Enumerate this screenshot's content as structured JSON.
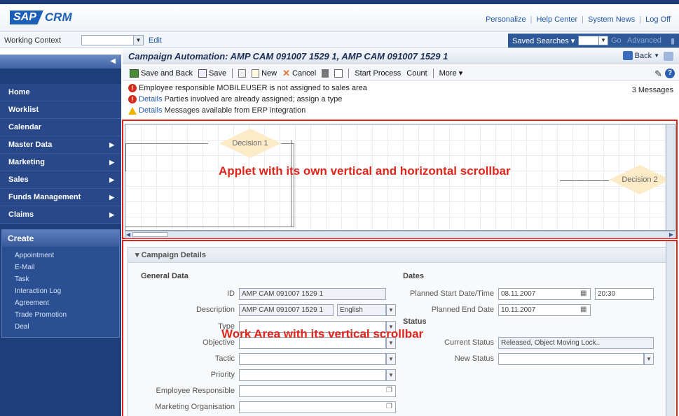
{
  "header": {
    "logo_sap": "SAP",
    "logo_product": "CRM",
    "links": [
      "Personalize",
      "Help Center",
      "System News",
      "Log Off"
    ]
  },
  "working_context": {
    "label": "Working Context",
    "value": "",
    "edit_label": "Edit",
    "saved_searches_label": "Saved Searches ▾",
    "go_label": "Go",
    "advanced_label": "Advanced"
  },
  "sidebar": {
    "items": [
      {
        "label": "Home",
        "has_arrow": false
      },
      {
        "label": "Worklist",
        "has_arrow": false
      },
      {
        "label": "Calendar",
        "has_arrow": false
      },
      {
        "label": "Master Data",
        "has_arrow": true
      },
      {
        "label": "Marketing",
        "has_arrow": true
      },
      {
        "label": "Sales",
        "has_arrow": true
      },
      {
        "label": "Funds Management",
        "has_arrow": true
      },
      {
        "label": "Claims",
        "has_arrow": true
      }
    ],
    "create_title": "Create",
    "create_items": [
      "Appointment",
      "E-Mail",
      "Task",
      "Interaction Log",
      "Agreement",
      "Trade Promotion",
      "Deal"
    ]
  },
  "page": {
    "title": "Campaign Automation: AMP CAM 091007 1529 1, AMP CAM 091007 1529 1",
    "back_label": "Back"
  },
  "toolbar": {
    "save_back": "Save and Back",
    "save": "Save",
    "new": "New",
    "cancel": "Cancel",
    "start_process": "Start Process",
    "count": "Count",
    "more": "More ▾"
  },
  "messages": {
    "count_label": "3 Messages",
    "list": [
      {
        "type": "error",
        "link": "",
        "text": "Employee responsible MOBILEUSER is not assigned to sales area"
      },
      {
        "type": "error",
        "link": "Details",
        "text": "Parties involved are already assigned; assign a type"
      },
      {
        "type": "warning",
        "link": "Details",
        "text": "Messages available from ERP integration"
      }
    ]
  },
  "applet": {
    "decision1": "Decision 1",
    "decision2": "Decision 2",
    "annotation": "Applet with its own vertical and horizontal scrollbar"
  },
  "work_area": {
    "annotation": "Work Area with its vertical scrollbar",
    "panel_title": "Campaign Details",
    "general_title": "General Data",
    "dates_title": "Dates",
    "status_title": "Status",
    "fields": {
      "id_label": "ID",
      "id_value": "AMP CAM 091007 1529 1",
      "description_label": "Description",
      "description_value": "AMP CAM 091007 1529 1",
      "language_value": "English",
      "type_label": "Type",
      "objective_label": "Objective",
      "tactic_label": "Tactic",
      "priority_label": "Priority",
      "employee_label": "Employee Responsible",
      "marketing_org_label": "Marketing Organisation",
      "start_label": "Planned Start Date/Time",
      "start_date": "08.11.2007",
      "start_time": "20:30",
      "end_label": "Planned End Date",
      "end_date": "10.11.2007",
      "current_status_label": "Current Status",
      "current_status_value": "Released, Object Moving Lock..",
      "new_status_label": "New Status"
    }
  },
  "colors": {
    "sidebar": "#1e3e7a",
    "highlight": "#e0261a",
    "decision_fill": "#fdebc8"
  }
}
